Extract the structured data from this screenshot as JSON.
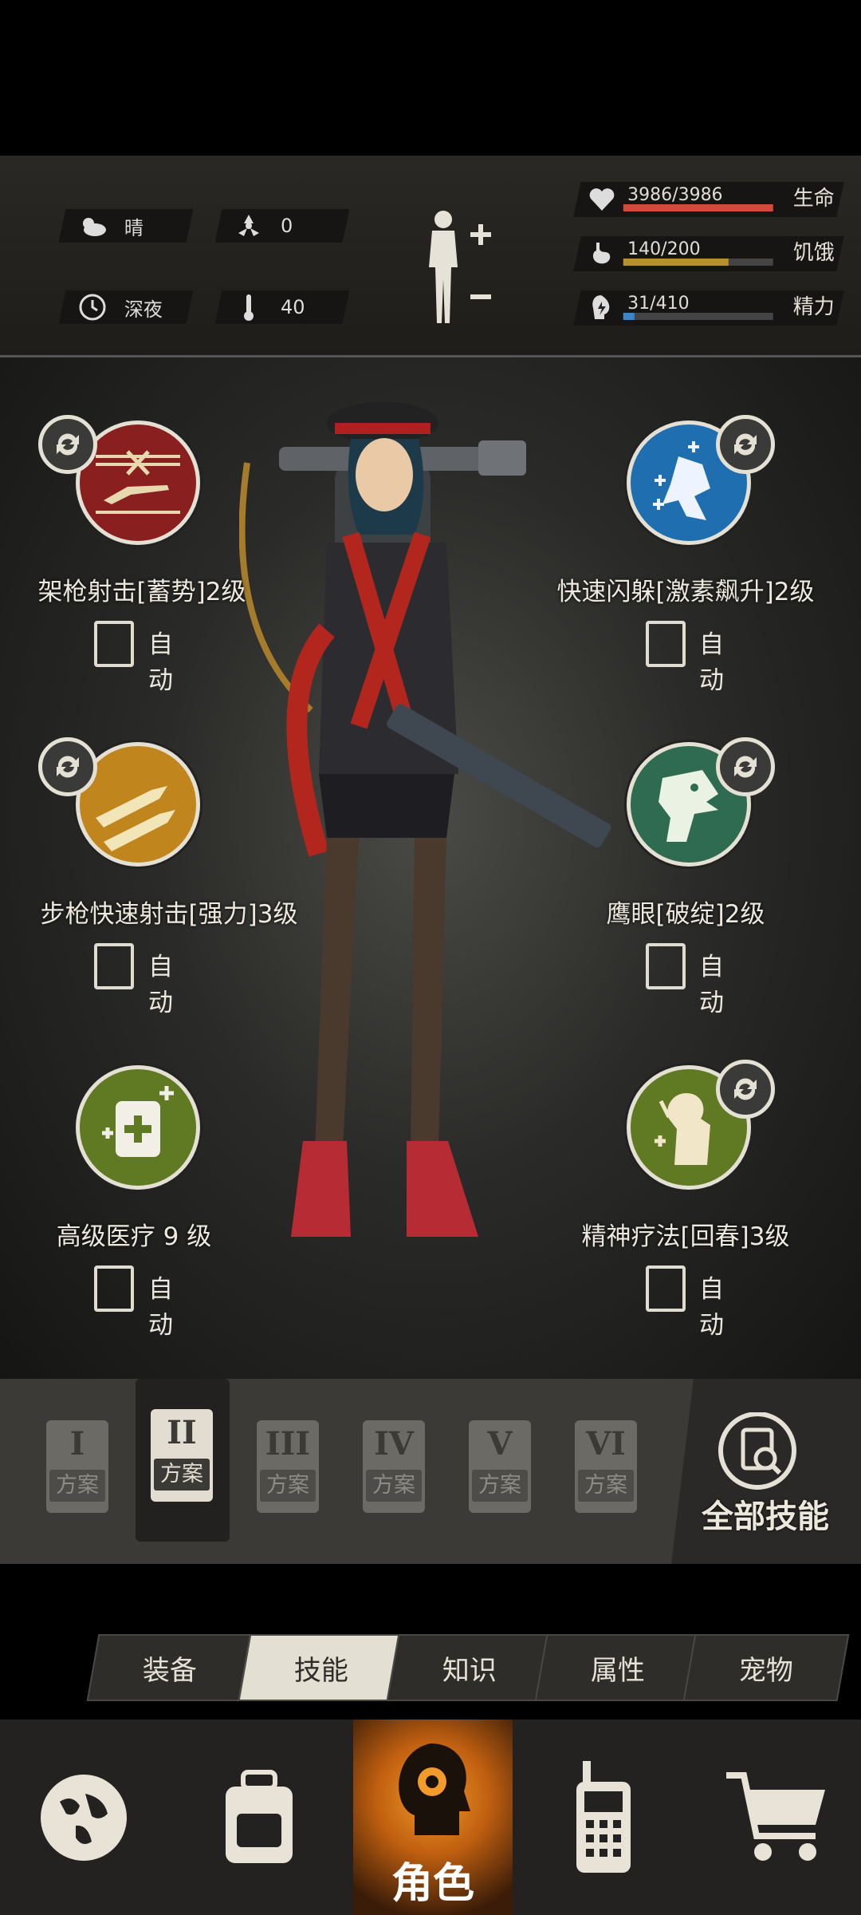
{
  "status": {
    "weather": "晴",
    "radiation": "0",
    "time_of_day": "深夜",
    "temperature": "40",
    "health": {
      "text": "3986/3986",
      "label": "生命",
      "fraction": 1.0,
      "color": "#d24a3c"
    },
    "hunger": {
      "text": "140/200",
      "label": "饥饿",
      "fraction": 0.7,
      "color": "#b8912e"
    },
    "energy": {
      "text": "31/410",
      "label": "精力",
      "fraction": 0.076,
      "color": "#3b86c9"
    }
  },
  "skills": [
    {
      "name": "架枪射击[蓄势]2级",
      "auto": "自动",
      "icon": "sniper-prone-icon",
      "color": "#8a1f1f",
      "swappable": true
    },
    {
      "name": "快速闪躲[激素飙升]2级",
      "auto": "自动",
      "icon": "dodge-icon",
      "color": "#1f6fb0",
      "swappable": true
    },
    {
      "name": "步枪快速射击[强力]3级",
      "auto": "自动",
      "icon": "rifle-bullets-icon",
      "color": "#c0851c",
      "swappable": true
    },
    {
      "name": "鹰眼[破绽]2级",
      "auto": "自动",
      "icon": "eagle-icon",
      "color": "#2e6b50",
      "swappable": true
    },
    {
      "name": "高级医疗 9 级",
      "auto": "自动",
      "icon": "medical-kit-icon",
      "color": "#5f7a22",
      "swappable": false
    },
    {
      "name": "精神疗法[回春]3级",
      "auto": "自动",
      "icon": "mental-healing-icon",
      "color": "#5f7a22",
      "swappable": true
    }
  ],
  "plans": [
    {
      "numeral": "I",
      "label": "方案"
    },
    {
      "numeral": "II",
      "label": "方案"
    },
    {
      "numeral": "III",
      "label": "方案"
    },
    {
      "numeral": "IV",
      "label": "方案"
    },
    {
      "numeral": "V",
      "label": "方案"
    },
    {
      "numeral": "VI",
      "label": "方案"
    }
  ],
  "active_plan": "II",
  "all_skills_label": "全部技能",
  "tabs": [
    "装备",
    "技能",
    "知识",
    "属性",
    "宠物"
  ],
  "active_tab": "技能",
  "nav": {
    "role_label": "角色"
  }
}
